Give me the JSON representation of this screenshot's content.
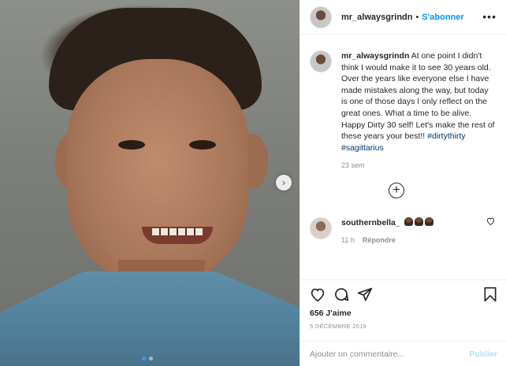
{
  "header": {
    "username": "mr_alwaysgrindn",
    "separator": "•",
    "follow_label": "S'abonner",
    "more_label": "•••"
  },
  "caption": {
    "username": "mr_alwaysgrindn",
    "text": "At one point I didn't think I would make it to see 30 years old. Over the years like everyone else I have made mistakes along the way, but today is one of those days I only reflect on the great ones. What a time to be alive. Happy Dirty 30 self! Let's make the rest of these years your best!!",
    "hashtags": [
      "#dirtythirty",
      "#sagittarius"
    ],
    "time_ago": "23 sem"
  },
  "load_more_label": "+",
  "comment": {
    "username": "southernbella_",
    "emojis": [
      "pray-emoji",
      "pray-emoji",
      "pray-emoji"
    ],
    "time_ago": "11 h",
    "reply_label": "Répondre"
  },
  "likes": "656 J'aime",
  "date": "5 DÉCEMBRE 2019",
  "add_comment": {
    "placeholder": "Ajouter un commentaire...",
    "publish_label": "Publier"
  },
  "carousel": {
    "slide_count": 2,
    "active_index": 0,
    "next_arrow": "›"
  },
  "colors": {
    "accent": "#0095f6",
    "publish_disabled": "#b2dffc",
    "muted": "#8e8e8e",
    "text": "#262626"
  }
}
